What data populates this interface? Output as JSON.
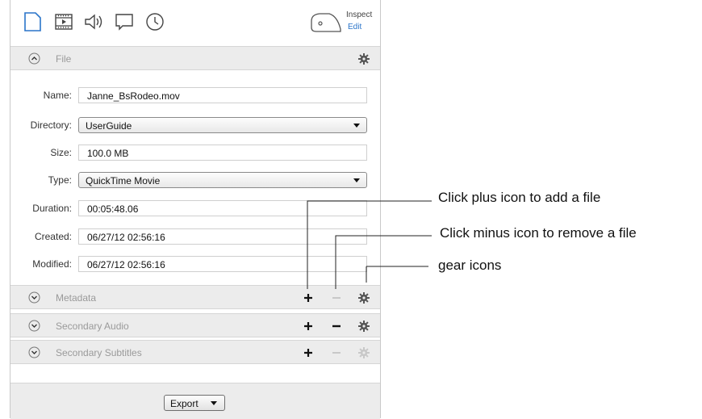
{
  "toolbar": {
    "icons": [
      "document-icon",
      "film-icon",
      "speaker-icon",
      "speech-bubble-icon",
      "clock-icon"
    ],
    "inspect_label": "Inspect",
    "edit_label": "Edit",
    "accent_color": "#2a74c9"
  },
  "file_section": {
    "title": "File",
    "fields": [
      {
        "label": "Name:",
        "value": "Janne_BsRodeo.mov",
        "kind": "text"
      },
      {
        "label": "Directory:",
        "value": "UserGuide",
        "kind": "select"
      },
      {
        "label": "Size:",
        "value": "100.0 MB",
        "kind": "text"
      },
      {
        "label": "Type:",
        "value": "QuickTime Movie",
        "kind": "select"
      },
      {
        "label": "Duration:",
        "value": "00:05:48.06",
        "kind": "text"
      },
      {
        "label": "Created:",
        "value": "06/27/12 02:56:16",
        "kind": "text"
      },
      {
        "label": "Modified:",
        "value": "06/27/12 02:56:16",
        "kind": "text"
      }
    ]
  },
  "sections": [
    {
      "title": "Metadata",
      "minus_enabled": false,
      "gear_enabled": true
    },
    {
      "title": "Secondary Audio",
      "minus_enabled": true,
      "gear_enabled": true
    },
    {
      "title": "Secondary Subtitles",
      "minus_enabled": false,
      "gear_enabled": false
    }
  ],
  "footer": {
    "export_label": "Export"
  },
  "callouts": {
    "plus": "Click plus icon to add a file",
    "minus": "Click minus icon to remove a file",
    "gear": "gear icons"
  }
}
